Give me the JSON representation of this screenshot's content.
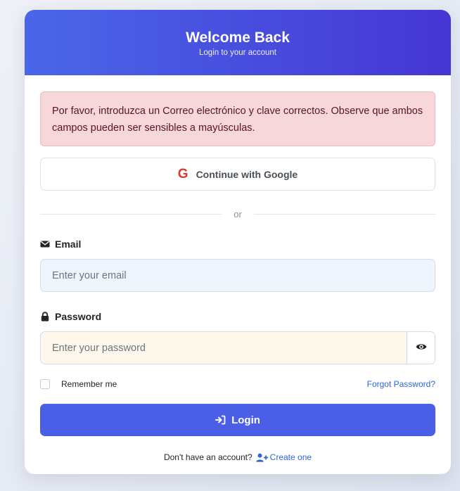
{
  "header": {
    "title": "Welcome Back",
    "subtitle": "Login to your account"
  },
  "alert": {
    "message": "Por favor, introduzca un Correo electrónico y clave correctos. Observe que ambos campos pueden ser sensibles a mayúsculas."
  },
  "google": {
    "icon": "google-g-icon",
    "letter": "G",
    "label": "Continue with Google"
  },
  "divider": {
    "text": "or"
  },
  "email": {
    "icon": "envelope-icon",
    "label": "Email",
    "placeholder": "Enter your email",
    "value": ""
  },
  "password": {
    "icon": "lock-icon",
    "label": "Password",
    "placeholder": "Enter your password",
    "value": "",
    "toggle_icon": "eye-icon"
  },
  "remember": {
    "label": "Remember me",
    "checked": false
  },
  "forgot": {
    "label": "Forgot Password?"
  },
  "login": {
    "icon": "sign-in-icon",
    "label": "Login"
  },
  "signup": {
    "prompt": "Don't have an account?",
    "icon": "user-plus-icon",
    "link": "Create one"
  },
  "colors": {
    "header_start": "#4a67e8",
    "header_end": "#4636d4",
    "primary": "#4a5fe6",
    "link": "#2c66d8",
    "alert_bg": "#f8d7da",
    "alert_text": "#58151c",
    "google_red": "#d73b2f"
  }
}
